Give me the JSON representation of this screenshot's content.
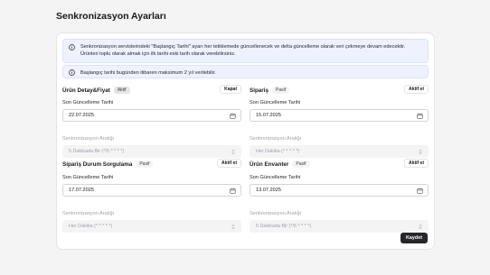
{
  "page": {
    "title": "Senkronizasyon Ayarları"
  },
  "info": {
    "message1": "Senkronizasyon servislerindeki \"Başlangıç Tarihi\" ayarı her tetiklemede güncellenecek ve delta güncelleme olarak veri çekmeye devam edecektir. Ürünleri toplu olarak almak için ilk tarihi eski tarih olarak verebilirsiniz.",
    "message2": "Başlangıç tarihi bugünden itibaren maksimum 2 yıl verilebilir."
  },
  "sections": [
    {
      "title": "Ürün Detay&Fiyat",
      "status": "Aktif",
      "button": "Kapat",
      "date_label": "Son Güncelleme Tarihi",
      "date_value": "22.07.2025",
      "interval_label": "Senkronizasyon Aralığı",
      "interval_value": "5 Dakikada Bir (*/5 * * * *)"
    },
    {
      "title": "Sipariş",
      "status": "Pasif",
      "button": "Aktif et",
      "date_label": "Son Güncelleme Tarihi",
      "date_value": "15.07.2025",
      "interval_label": "Senkronizasyon Aralığı",
      "interval_value": "Her Dakika (* * * * *)"
    },
    {
      "title": "Sipariş Durum Sorgulama",
      "status": "Pasif",
      "button": "Aktif et",
      "date_label": "Son Güncelleme Tarihi",
      "date_value": "17.07.2025",
      "interval_label": "Senkronizasyon Aralığı",
      "interval_value": "Her Dakika (* * * * *)"
    },
    {
      "title": "Ürün Envanter",
      "status": "Pasif",
      "button": "Aktif et",
      "date_label": "Son Güncelleme Tarihi",
      "date_value": "13.07.2025",
      "interval_label": "Senkronizasyon Aralığı",
      "interval_value": "5 Dakikada Bir (*/5 * * * *)"
    }
  ],
  "actions": {
    "save": "Kaydet"
  },
  "colors": {
    "info_bg": "#eef2ff",
    "primary_button": "#27272a"
  }
}
